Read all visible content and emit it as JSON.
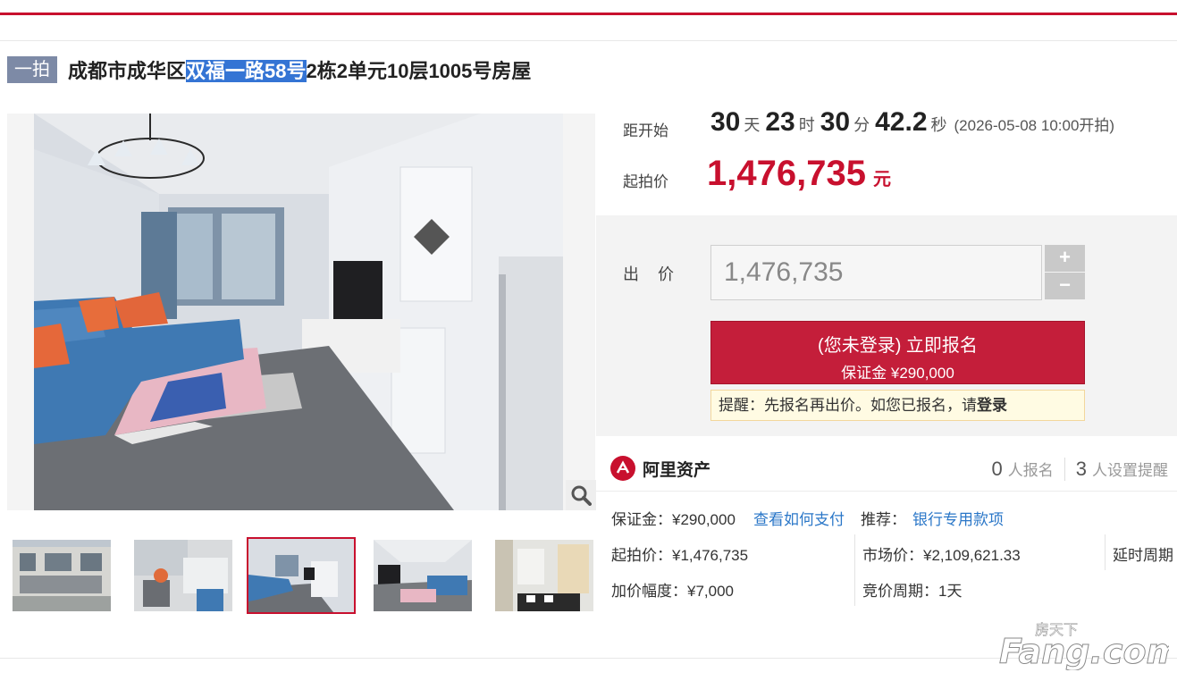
{
  "auction": {
    "badge": "一拍",
    "title_before": "成都市成华区",
    "title_highlight": "双福一路58号",
    "title_after": "2栋2单元10层1005号房屋"
  },
  "countdown": {
    "label": "距开始",
    "days": "30",
    "days_unit": "天",
    "hours": "23",
    "hours_unit": "时",
    "minutes": "30",
    "minutes_unit": "分",
    "seconds": "42.2",
    "seconds_unit": "秒",
    "start_time": "(2026-05-08 10:00开拍)"
  },
  "start_price": {
    "label": "起拍价",
    "value": "1,476,735",
    "unit": "元"
  },
  "bid": {
    "label": "出 价",
    "input_value": "1,476,735",
    "plus": "+",
    "minus": "−",
    "signup_line1": "(您未登录) 立即报名",
    "signup_line2": "保证金 ¥290,000",
    "remind_text": "提醒：先报名再出价。如您已报名，请",
    "remind_link": "登录"
  },
  "platform": {
    "name": "阿里资产",
    "signups": "0",
    "signups_label": "人报名",
    "reminders": "3",
    "reminders_label": "人设置提醒"
  },
  "details": {
    "deposit": "保证金：¥290,000",
    "how_to_pay": "查看如何支付",
    "recommend_label": "推荐：",
    "recommend_link": "银行专用款项",
    "start_price": "起拍价：¥1,476,735",
    "market_price": "市场价：¥2,109,621.33",
    "delay_period": "延时周期",
    "increment": "加价幅度：¥7,000",
    "bid_period": "竞价周期：1天"
  },
  "watermark": {
    "line1": "房天下",
    "line2": "Fang.com"
  },
  "icons": {
    "zoom": "magnifier-icon",
    "logo": "ali-asset-logo-icon"
  },
  "colors": {
    "accent": "#c8102e",
    "badge": "#7d8aa6",
    "link": "#2b77c8",
    "highlight": "#3474d4"
  }
}
